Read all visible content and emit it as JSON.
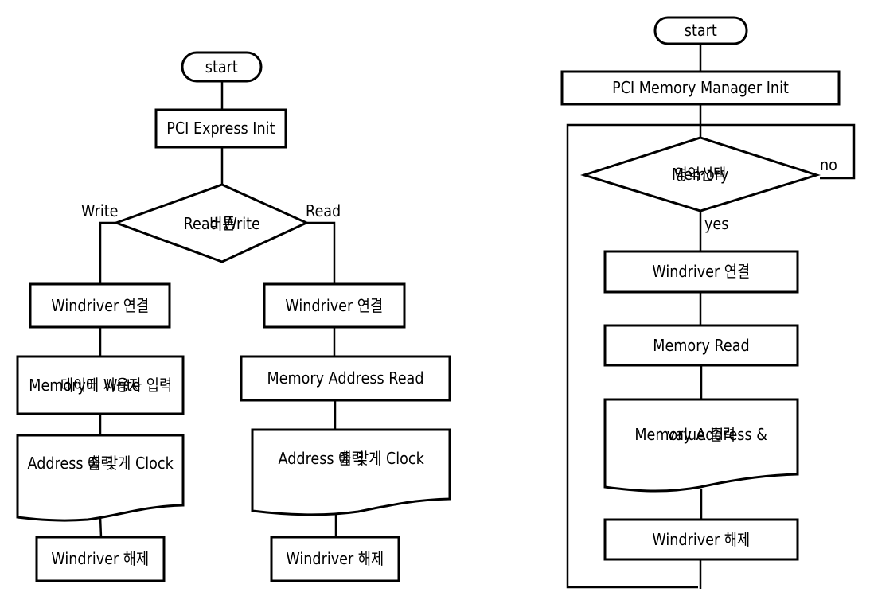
{
  "left_flowchart": {
    "start": "start",
    "init": "PCI  Express Init",
    "decision": [
      "Read Write",
      "버튼"
    ],
    "branch_write_label": "Write",
    "branch_read_label": "Read",
    "write_branch": {
      "connect": "Windriver 연결",
      "write_data": [
        "Memory에 사용자 입력",
        "데이터 Write"
      ],
      "clock_output": [
        "Address 에 맞게 Clock",
        "출력"
      ],
      "release": "Windriver 해제"
    },
    "read_branch": {
      "connect": "Windriver 연결",
      "address_read": "Memory Address Read",
      "clock_output": [
        "Address 에 맞게 Clock",
        "출력"
      ],
      "release": "Windriver 해제"
    }
  },
  "right_flowchart": {
    "start": "start",
    "init": "PCI Memory Manager Init",
    "decision": [
      "Memory",
      "영역선택"
    ],
    "no_label": "no",
    "yes_label": "yes",
    "connect": "Windriver 연결",
    "memory_read": "Memory Read",
    "output": [
      "Memory Address &",
      "value  출력"
    ],
    "release": "Windriver 해제"
  }
}
